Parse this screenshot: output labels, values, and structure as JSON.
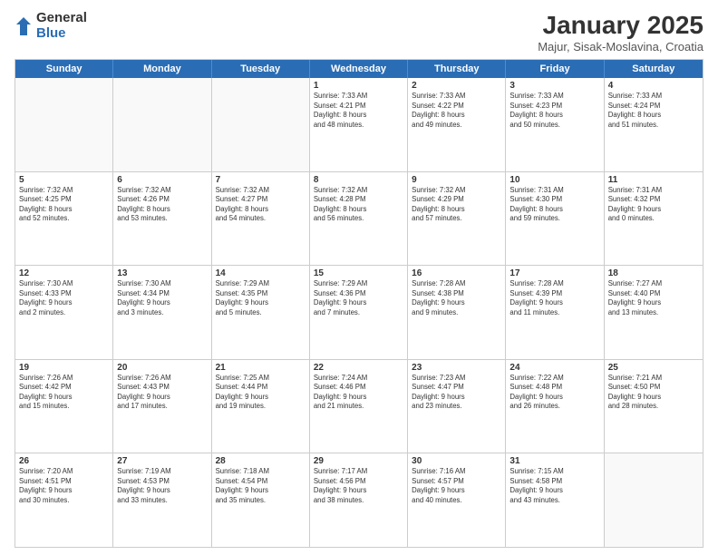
{
  "logo": {
    "general": "General",
    "blue": "Blue"
  },
  "header": {
    "month": "January 2025",
    "location": "Majur, Sisak-Moslavina, Croatia"
  },
  "dayHeaders": [
    "Sunday",
    "Monday",
    "Tuesday",
    "Wednesday",
    "Thursday",
    "Friday",
    "Saturday"
  ],
  "weeks": [
    [
      {
        "day": "",
        "empty": true
      },
      {
        "day": "",
        "empty": true
      },
      {
        "day": "",
        "empty": true
      },
      {
        "day": "1",
        "sunrise": "7:33 AM",
        "sunset": "4:21 PM",
        "daylight": "8 hours and 48 minutes."
      },
      {
        "day": "2",
        "sunrise": "7:33 AM",
        "sunset": "4:22 PM",
        "daylight": "8 hours and 49 minutes."
      },
      {
        "day": "3",
        "sunrise": "7:33 AM",
        "sunset": "4:23 PM",
        "daylight": "8 hours and 50 minutes."
      },
      {
        "day": "4",
        "sunrise": "7:33 AM",
        "sunset": "4:24 PM",
        "daylight": "8 hours and 51 minutes."
      }
    ],
    [
      {
        "day": "5",
        "sunrise": "7:32 AM",
        "sunset": "4:25 PM",
        "daylight": "8 hours and 52 minutes."
      },
      {
        "day": "6",
        "sunrise": "7:32 AM",
        "sunset": "4:26 PM",
        "daylight": "8 hours and 53 minutes."
      },
      {
        "day": "7",
        "sunrise": "7:32 AM",
        "sunset": "4:27 PM",
        "daylight": "8 hours and 54 minutes."
      },
      {
        "day": "8",
        "sunrise": "7:32 AM",
        "sunset": "4:28 PM",
        "daylight": "8 hours and 56 minutes."
      },
      {
        "day": "9",
        "sunrise": "7:32 AM",
        "sunset": "4:29 PM",
        "daylight": "8 hours and 57 minutes."
      },
      {
        "day": "10",
        "sunrise": "7:31 AM",
        "sunset": "4:30 PM",
        "daylight": "8 hours and 59 minutes."
      },
      {
        "day": "11",
        "sunrise": "7:31 AM",
        "sunset": "4:32 PM",
        "daylight": "9 hours and 0 minutes."
      }
    ],
    [
      {
        "day": "12",
        "sunrise": "7:30 AM",
        "sunset": "4:33 PM",
        "daylight": "9 hours and 2 minutes."
      },
      {
        "day": "13",
        "sunrise": "7:30 AM",
        "sunset": "4:34 PM",
        "daylight": "9 hours and 3 minutes."
      },
      {
        "day": "14",
        "sunrise": "7:29 AM",
        "sunset": "4:35 PM",
        "daylight": "9 hours and 5 minutes."
      },
      {
        "day": "15",
        "sunrise": "7:29 AM",
        "sunset": "4:36 PM",
        "daylight": "9 hours and 7 minutes."
      },
      {
        "day": "16",
        "sunrise": "7:28 AM",
        "sunset": "4:38 PM",
        "daylight": "9 hours and 9 minutes."
      },
      {
        "day": "17",
        "sunrise": "7:28 AM",
        "sunset": "4:39 PM",
        "daylight": "9 hours and 11 minutes."
      },
      {
        "day": "18",
        "sunrise": "7:27 AM",
        "sunset": "4:40 PM",
        "daylight": "9 hours and 13 minutes."
      }
    ],
    [
      {
        "day": "19",
        "sunrise": "7:26 AM",
        "sunset": "4:42 PM",
        "daylight": "9 hours and 15 minutes."
      },
      {
        "day": "20",
        "sunrise": "7:26 AM",
        "sunset": "4:43 PM",
        "daylight": "9 hours and 17 minutes."
      },
      {
        "day": "21",
        "sunrise": "7:25 AM",
        "sunset": "4:44 PM",
        "daylight": "9 hours and 19 minutes."
      },
      {
        "day": "22",
        "sunrise": "7:24 AM",
        "sunset": "4:46 PM",
        "daylight": "9 hours and 21 minutes."
      },
      {
        "day": "23",
        "sunrise": "7:23 AM",
        "sunset": "4:47 PM",
        "daylight": "9 hours and 23 minutes."
      },
      {
        "day": "24",
        "sunrise": "7:22 AM",
        "sunset": "4:48 PM",
        "daylight": "9 hours and 26 minutes."
      },
      {
        "day": "25",
        "sunrise": "7:21 AM",
        "sunset": "4:50 PM",
        "daylight": "9 hours and 28 minutes."
      }
    ],
    [
      {
        "day": "26",
        "sunrise": "7:20 AM",
        "sunset": "4:51 PM",
        "daylight": "9 hours and 30 minutes."
      },
      {
        "day": "27",
        "sunrise": "7:19 AM",
        "sunset": "4:53 PM",
        "daylight": "9 hours and 33 minutes."
      },
      {
        "day": "28",
        "sunrise": "7:18 AM",
        "sunset": "4:54 PM",
        "daylight": "9 hours and 35 minutes."
      },
      {
        "day": "29",
        "sunrise": "7:17 AM",
        "sunset": "4:56 PM",
        "daylight": "9 hours and 38 minutes."
      },
      {
        "day": "30",
        "sunrise": "7:16 AM",
        "sunset": "4:57 PM",
        "daylight": "9 hours and 40 minutes."
      },
      {
        "day": "31",
        "sunrise": "7:15 AM",
        "sunset": "4:58 PM",
        "daylight": "9 hours and 43 minutes."
      },
      {
        "day": "",
        "empty": true
      }
    ]
  ]
}
